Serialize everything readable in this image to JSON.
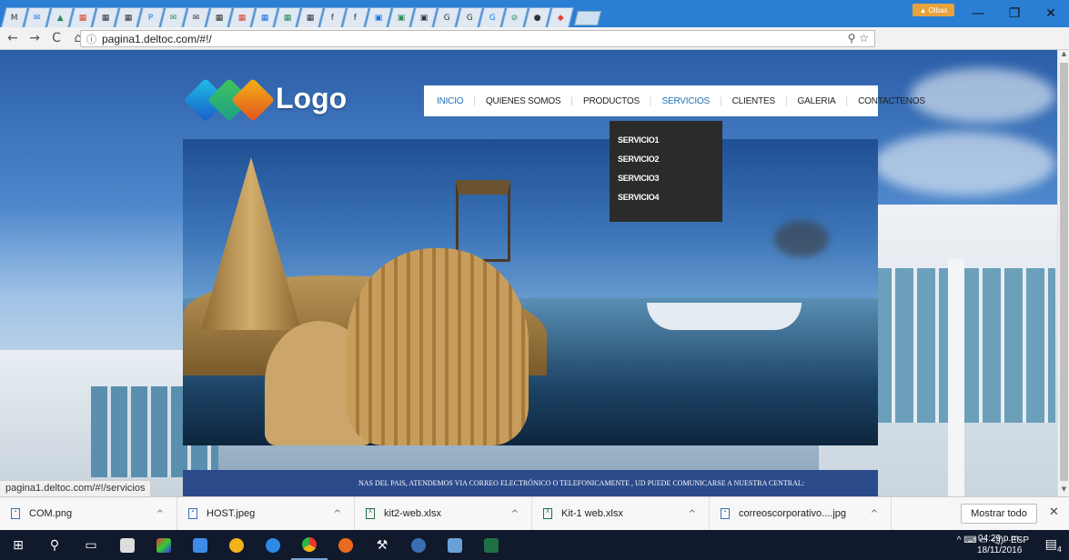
{
  "browser": {
    "tab_glyphs": [
      "M",
      "✉",
      "▲",
      "▦",
      "▦",
      "▦",
      "P",
      "✉",
      "✉",
      "▦",
      "▦",
      "▦",
      "▦",
      "▦",
      "f",
      "f",
      "▣",
      "▣",
      "▣",
      "G",
      "G",
      "G",
      "⊘",
      "●",
      "◆"
    ],
    "profile_label": "Olbax",
    "url": "pagina1.deltoc.com/#!/",
    "nav": {
      "back": "←",
      "forward": "→",
      "reload": "C",
      "home": "⌂"
    },
    "omni_icons": {
      "info": "ⓘ",
      "zoom": "⚲",
      "star": "☆"
    },
    "window_controls": {
      "minimize": "—",
      "restore": "❐",
      "close": "✕"
    }
  },
  "site": {
    "logo_text": "Logo",
    "menu": [
      {
        "label": "INICIO",
        "active": true
      },
      {
        "label": "QUIENES SOMOS"
      },
      {
        "label": "PRODUCTOS"
      },
      {
        "label": "SERVICIOS",
        "active": true
      },
      {
        "label": "CLIENTES"
      },
      {
        "label": "GALERIA"
      },
      {
        "label": "CONTACTENOS"
      }
    ],
    "services_dropdown": [
      "SERVICIO1",
      "SERVICIO2",
      "SERVICIO3",
      "SERVICIO4"
    ],
    "strip_text": "NAS DEL PAIS, ATENDEMOS VIA CORREO ELECTRÓNICO O TELEFONICAMENTE , UD PUEDE COMUNICARSE A NUESTRA CENTRAL:"
  },
  "status_url": "pagina1.deltoc.com/#!/servicios",
  "downloads": {
    "items": [
      {
        "name": "COM.png",
        "type": "img"
      },
      {
        "name": "HOST.jpeg",
        "type": "img"
      },
      {
        "name": "kit2-web.xlsx",
        "type": "xl"
      },
      {
        "name": "Kit-1 web.xlsx",
        "type": "xl"
      },
      {
        "name": "correoscorporativo....jpg",
        "type": "img"
      }
    ],
    "show_all": "Mostrar todo",
    "close": "✕"
  },
  "taskbar": {
    "lang": "ESP",
    "time": "04:29 p.m.",
    "date": "18/11/2016",
    "tray_icons": "^ ⌨ ▭ ◁))",
    "notification_count": "4"
  },
  "colors": {
    "tab_strip": "#2a7fd4",
    "menu_active": "#1f6fb5",
    "dropdown_bg": "#2b2b2b",
    "info_strip": "#2b4a8a",
    "taskbar": "#101a2c"
  }
}
